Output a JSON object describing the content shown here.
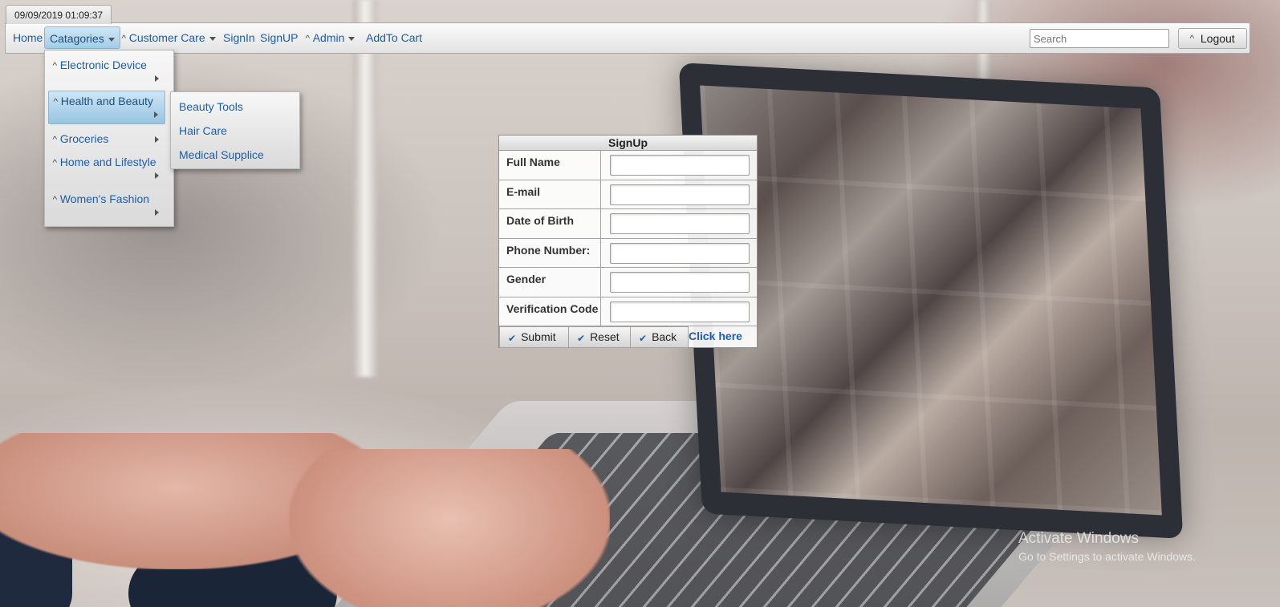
{
  "clock": "09/09/2019 01:09:37",
  "nav": {
    "home": "Home",
    "categories": "Catagories",
    "customer_care": "Customer Care",
    "signin": "SignIn",
    "signup": "SignUP",
    "admin": "Admin",
    "addtocart": "AddTo Cart"
  },
  "search": {
    "placeholder": "Search"
  },
  "logout_label": "Logout",
  "categories_menu": {
    "items": [
      "Electronic Device",
      "Health and Beauty",
      "Groceries",
      "Home and Lifestyle",
      "Women's Fashion"
    ],
    "selected": "Health and Beauty"
  },
  "health_beauty_submenu": {
    "items": [
      "Beauty Tools",
      "Hair Care",
      "Medical Supplice"
    ]
  },
  "signup_form": {
    "title": "SignUp",
    "fields": [
      {
        "label": "Full Name",
        "value": ""
      },
      {
        "label": "E-mail",
        "value": ""
      },
      {
        "label": "Date of Birth",
        "value": ""
      },
      {
        "label": "Phone Number:",
        "value": ""
      },
      {
        "label": "Gender",
        "value": ""
      },
      {
        "label": "Verification Code",
        "value": ""
      }
    ],
    "buttons": {
      "submit": "Submit",
      "reset": "Reset",
      "back": "Back"
    },
    "link": "Click here"
  },
  "watermark": {
    "line1": "Activate Windows",
    "line2": "Go to Settings to activate Windows."
  },
  "colors": {
    "link": "#1c5ea8",
    "active_menu": "#a5cde6"
  }
}
